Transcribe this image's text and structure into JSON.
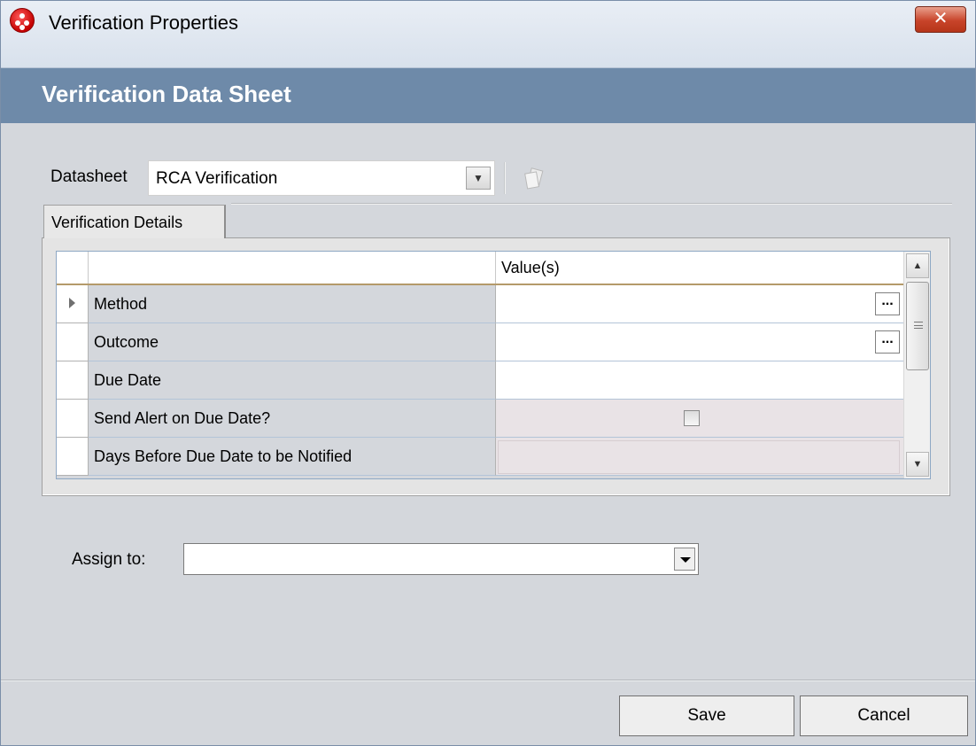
{
  "window": {
    "title": "Verification Properties",
    "close_label": "✕"
  },
  "header": {
    "title": "Verification Data Sheet"
  },
  "datasheet": {
    "label": "Datasheet",
    "selected": "RCA Verification",
    "dropdown_icon": "chevron-down-icon",
    "action_icon": "copy-icon"
  },
  "tabs": [
    {
      "label": "Verification Details",
      "active": true
    }
  ],
  "grid": {
    "columns": [
      "",
      "",
      "Value(s)"
    ],
    "rows": [
      {
        "field": "Method",
        "value": "",
        "has_ellipsis": true,
        "current": true
      },
      {
        "field": "Outcome",
        "value": "",
        "has_ellipsis": true
      },
      {
        "field": "Due Date",
        "value": ""
      },
      {
        "field": "Send Alert on Due Date?",
        "value": "",
        "checkbox": false
      },
      {
        "field": "Days Before Due Date to be Notified",
        "value": ""
      }
    ],
    "ellipsis_label": "..."
  },
  "assign": {
    "label": "Assign to:",
    "value": ""
  },
  "footer": {
    "save_label": "Save",
    "cancel_label": "Cancel"
  },
  "colors": {
    "header_band": "#6e8aa9",
    "window_bg": "#d4d7dc",
    "close_button": "#c8442a"
  }
}
